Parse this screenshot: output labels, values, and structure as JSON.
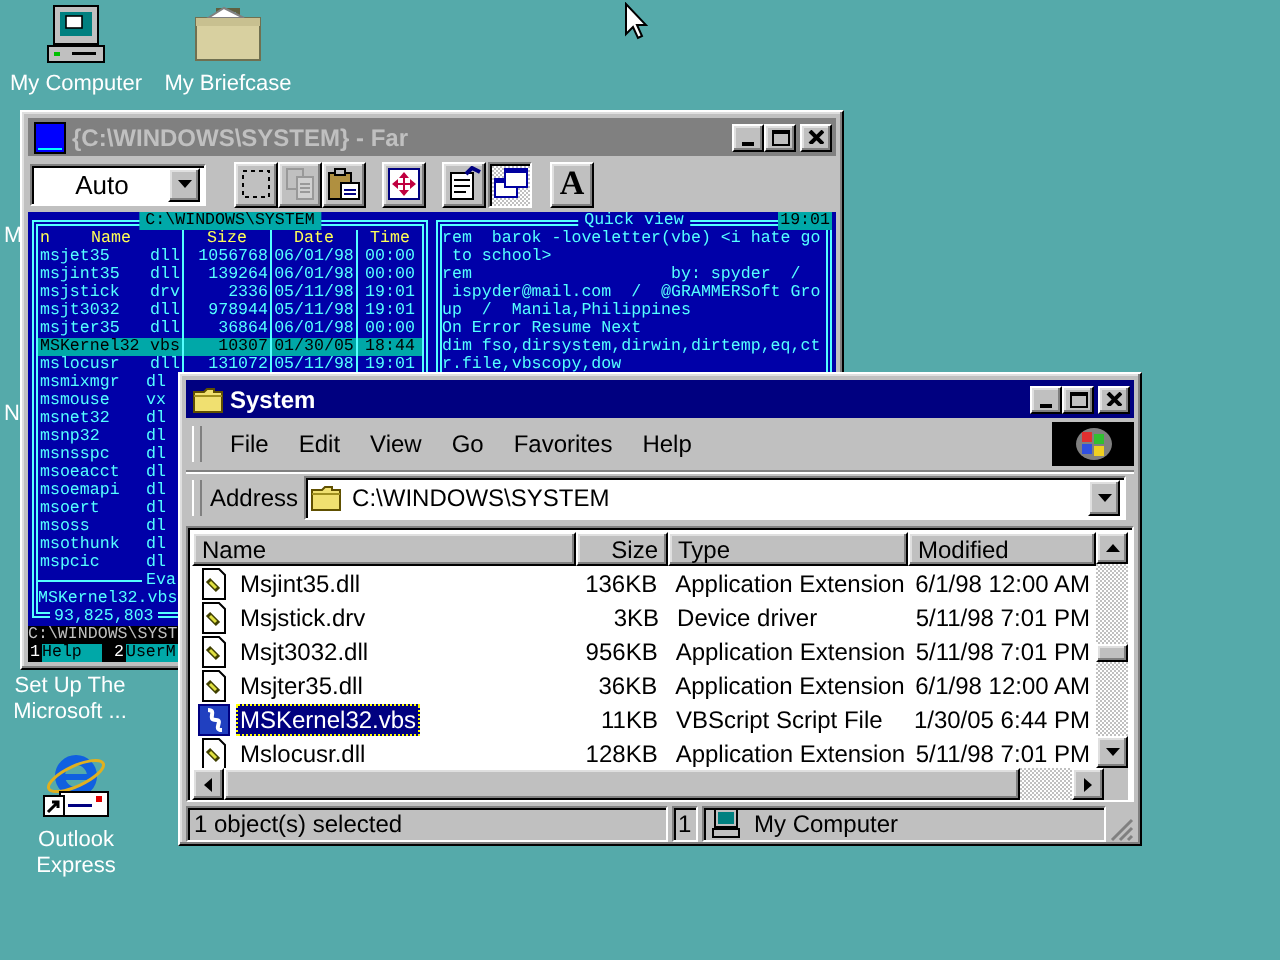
{
  "desktop": {
    "icons": [
      {
        "kind": "computer",
        "label": "My Computer"
      },
      {
        "kind": "briefcase",
        "label": "My Briefcase"
      },
      {
        "kind": "hidden",
        "label": "M"
      },
      {
        "kind": "hidden",
        "label": "N"
      },
      {
        "kind": "hidden",
        "label": "Set Up The Microsoft ..."
      },
      {
        "kind": "outlook",
        "label": "Outlook Express"
      }
    ]
  },
  "far_window": {
    "title": "{C:\\WINDOWS\\SYSTEM} - Far",
    "active": false,
    "toolbar": {
      "combo": "Auto",
      "buttons": [
        {
          "kind": "select",
          "disabled": false,
          "pressed": false
        },
        {
          "kind": "copy",
          "disabled": true,
          "pressed": false
        },
        {
          "kind": "paste",
          "disabled": false,
          "pressed": false
        },
        {
          "kind": "move",
          "disabled": false,
          "pressed": false
        },
        {
          "kind": "properties",
          "disabled": false,
          "pressed": false
        },
        {
          "kind": "windows",
          "disabled": false,
          "pressed": true
        },
        {
          "kind": "font",
          "label": "A",
          "disabled": false,
          "pressed": false
        }
      ]
    },
    "left_panel": {
      "path": "C:\\WINDOWS\\SYSTEM",
      "columns": [
        "n",
        "Name",
        "Size",
        "Date",
        "Time"
      ],
      "rows": [
        {
          "name": "msjet35",
          "ext": "dll",
          "size": "1056768",
          "date": "06/01/98",
          "time": "00:00",
          "selected": false
        },
        {
          "name": "msjint35",
          "ext": "dll",
          "size": "139264",
          "date": "06/01/98",
          "time": "00:00",
          "selected": false
        },
        {
          "name": "msjstick",
          "ext": "drv",
          "size": "2336",
          "date": "05/11/98",
          "time": "19:01",
          "selected": false
        },
        {
          "name": "msjt3032",
          "ext": "dll",
          "size": "978944",
          "date": "05/11/98",
          "time": "19:01",
          "selected": false
        },
        {
          "name": "msjter35",
          "ext": "dll",
          "size": "36864",
          "date": "06/01/98",
          "time": "00:00",
          "selected": false
        },
        {
          "name": "MSKernel32",
          "ext": "vbs",
          "size": "10307",
          "date": "01/30/05",
          "time": "18:44",
          "selected": true
        },
        {
          "name": "mslocusr",
          "ext": "dll",
          "size": "131072",
          "date": "05/11/98",
          "time": "19:01",
          "selected": false
        },
        {
          "name": "msmixmgr",
          "ext": "dl",
          "selected": false
        },
        {
          "name": "msmouse",
          "ext": "vx",
          "selected": false
        },
        {
          "name": "msnet32",
          "ext": "dl",
          "selected": false
        },
        {
          "name": "msnp32",
          "ext": "dl",
          "selected": false
        },
        {
          "name": "msnsspc",
          "ext": "dl",
          "selected": false
        },
        {
          "name": "msoeacct",
          "ext": "dl",
          "selected": false
        },
        {
          "name": "msoemapi",
          "ext": "dl",
          "selected": false
        },
        {
          "name": "msoert",
          "ext": "dl",
          "selected": false
        },
        {
          "name": "msoss",
          "ext": "dl",
          "selected": false
        },
        {
          "name": "msothunk",
          "ext": "dl",
          "selected": false
        },
        {
          "name": "mspcic",
          "ext": "dl",
          "selected": false
        }
      ],
      "info": "Eva",
      "current_file": "MSKernel32.vbs",
      "total": "93,825,803"
    },
    "right_panel": {
      "title": "Quick view",
      "clock": "19:01",
      "lines": [
        "rem  barok -loveletter(vbe) <i hate go",
        " to school>",
        "rem                    by: spyder  /",
        " ispyder@mail.com  /  @GRAMMERSoft Gro",
        "up  /  Manila,Philippines",
        "On Error Resume Next",
        "dim fso,dirsystem,dirwin,dirtemp,eq,ct",
        "r.file,vbscopy,dow"
      ]
    },
    "command_line": "C:\\WINDOWS\\SYST",
    "keybar": [
      {
        "key": "1",
        "label": "Help"
      },
      {
        "key": "2",
        "label": "UserM"
      }
    ]
  },
  "explorer_window": {
    "title": "System",
    "active": true,
    "menu": [
      "File",
      "Edit",
      "View",
      "Go",
      "Favorites",
      "Help"
    ],
    "address_label": "Address",
    "address": "C:\\WINDOWS\\SYSTEM",
    "columns": [
      "Name",
      "Size",
      "Type",
      "Modified"
    ],
    "rows": [
      {
        "kind": "dll",
        "name": "Msjint35.dll",
        "size": "136KB",
        "type": "Application Extension",
        "modified": "6/1/98 12:00 AM",
        "selected": false
      },
      {
        "kind": "dll",
        "name": "Msjstick.drv",
        "size": "3KB",
        "type": "Device driver",
        "modified": "5/11/98 7:01 PM",
        "selected": false
      },
      {
        "kind": "dll",
        "name": "Msjt3032.dll",
        "size": "956KB",
        "type": "Application Extension",
        "modified": "5/11/98 7:01 PM",
        "selected": false
      },
      {
        "kind": "dll",
        "name": "Msjter35.dll",
        "size": "36KB",
        "type": "Application Extension",
        "modified": "6/1/98 12:00 AM",
        "selected": false
      },
      {
        "kind": "vbs",
        "name": "MSKernel32.vbs",
        "size": "11KB",
        "type": "VBScript Script File",
        "modified": "1/30/05 6:44 PM",
        "selected": true
      },
      {
        "kind": "dll",
        "name": "Mslocusr.dll",
        "size": "128KB",
        "type": "Application Extension",
        "modified": "5/11/98 7:01 PM",
        "selected": false
      }
    ],
    "status": {
      "text": "1 object(s) selected",
      "count": "1",
      "zone": "My Computer"
    }
  }
}
